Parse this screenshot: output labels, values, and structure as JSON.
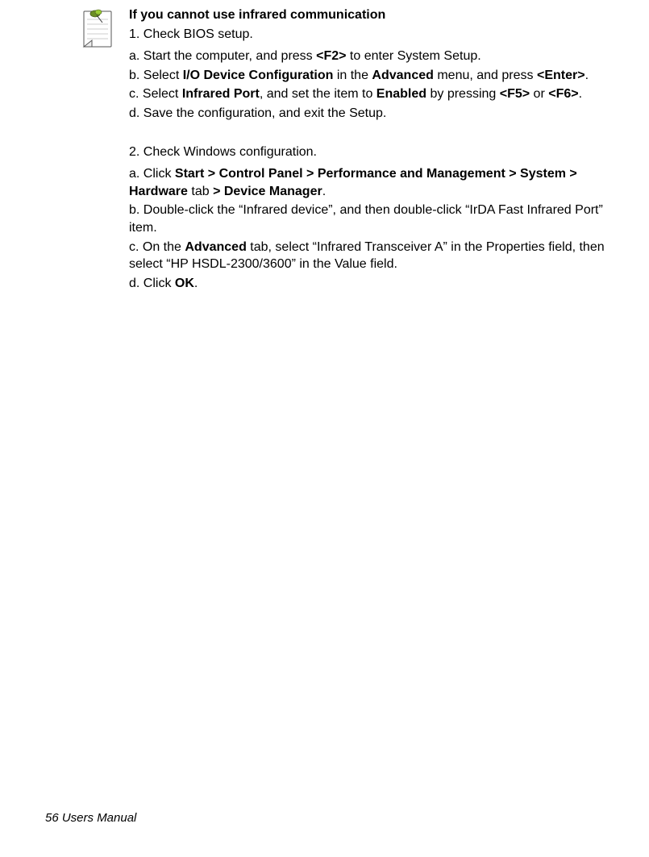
{
  "heading": "If you cannot use infrared communication",
  "s1_title": "1. Check BIOS setup.",
  "s1_a_1": "a. Start the computer, and press ",
  "s1_a_b1": "<F2>",
  "s1_a_2": " to enter System Setup.",
  "s1_b_1": "b. Select ",
  "s1_b_b1": "I/O Device Configuration",
  "s1_b_2": " in the ",
  "s1_b_b2": "Advanced",
  "s1_b_3": " menu, and press ",
  "s1_b_b3": "<Enter>",
  "s1_b_4": ".",
  "s1_c_1": "c. Select ",
  "s1_c_b1": "Infrared Port",
  "s1_c_2": ", and set the item to ",
  "s1_c_b2": "Enabled",
  "s1_c_3": " by pressing ",
  "s1_c_b3": "<F5>",
  "s1_c_4": " or ",
  "s1_c_b4": "<F6>",
  "s1_c_5": ".",
  "s1_d": "d. Save the configuration, and exit the Setup.",
  "s2_title": "2. Check Windows configuration.",
  "s2_a_1": "a. Click ",
  "s2_a_b1": "Start > Control Panel > Performance and Management > System > Hardware",
  "s2_a_2": " tab ",
  "s2_a_b2": "> Device Manager",
  "s2_a_3": ".",
  "s2_b": "b. Double-click the “Infrared device”, and then double-click “IrDA Fast Infrared Port” item.",
  "s2_c_1": "c. On the ",
  "s2_c_b1": "Advanced",
  "s2_c_2": " tab, select “Infrared Transceiver A” in the Properties field, then select “HP HSDL-2300/3600” in the Value field.",
  "s2_d_1": "d. Click ",
  "s2_d_b1": "OK",
  "s2_d_2": ".",
  "footer": "56  Users Manual"
}
